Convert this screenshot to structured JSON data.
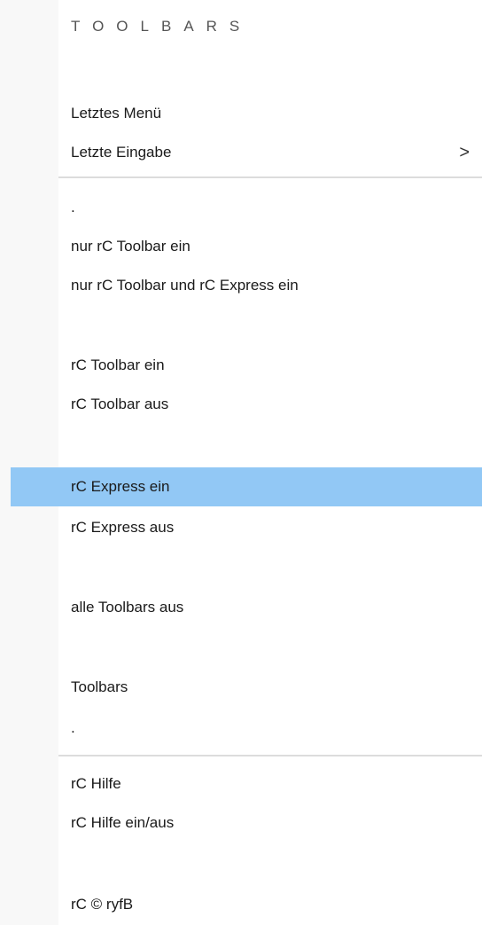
{
  "menu": {
    "title": "TOOLBARS",
    "items": [
      {
        "label": "Letztes Menü"
      },
      {
        "label": "Letzte Eingabe",
        "submenu_arrow": ">"
      },
      {
        "label": "."
      },
      {
        "label": "nur rC Toolbar ein"
      },
      {
        "label": "nur rC Toolbar und rC Express ein"
      },
      {
        "label": "rC Toolbar ein"
      },
      {
        "label": "rC Toolbar aus"
      },
      {
        "label": "rC Express ein",
        "highlighted": true
      },
      {
        "label": "rC Express aus"
      },
      {
        "label": "alle Toolbars aus"
      },
      {
        "label": "Toolbars"
      },
      {
        "label": "."
      },
      {
        "label": "rC Hilfe"
      },
      {
        "label": "rC Hilfe ein/aus"
      },
      {
        "label": "rC © ryfB"
      }
    ],
    "highlight_color": "#92c8f5"
  }
}
